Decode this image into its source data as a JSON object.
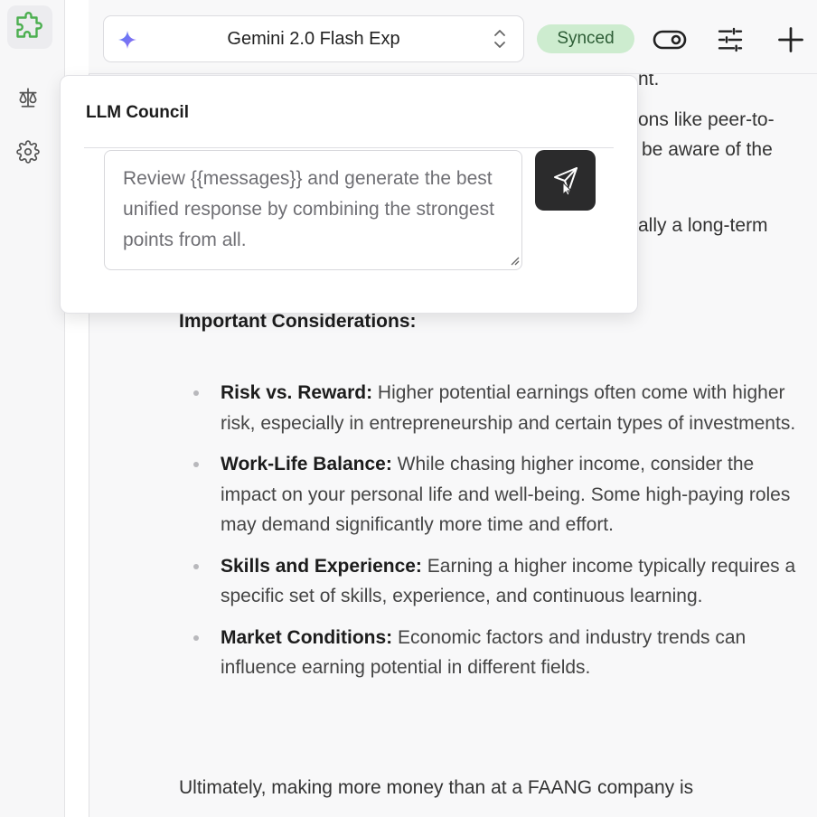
{
  "rail": {
    "items": [
      {
        "icon": "puzzle-icon"
      },
      {
        "icon": "scale-icon"
      },
      {
        "icon": "gear-icon"
      }
    ]
  },
  "topbar": {
    "model_label": "Gemini 2.0 Flash Exp",
    "model_icon": "sparkle-icon",
    "sync_badge": "Synced",
    "sync_badge_color": "#cdeccf",
    "actions": [
      "toggle-icon",
      "sliders-icon",
      "plus-icon"
    ]
  },
  "background_text": {
    "line1": "nt.",
    "line2": "ons like peer-to-",
    "line3": "be aware of the",
    "line4": "ally a long-term"
  },
  "content": {
    "heading": "Important Considerations:",
    "bullets": [
      {
        "title": "Risk vs. Reward:",
        "text": " Higher potential earnings often come with higher risk, especially in entrepreneurship and certain types of investments."
      },
      {
        "title": "Work-Life Balance:",
        "text": " While chasing higher income, consider the impact on your personal life and well-being. Some high-paying roles may demand significantly more time and effort."
      },
      {
        "title": "Skills and Experience:",
        "text": " Earning a higher income typically requires a specific set of skills, experience, and continuous learning."
      },
      {
        "title": "Market Conditions:",
        "text": " Economic factors and industry trends can influence earning potential in different fields."
      }
    ],
    "final": "Ultimately, making more money than at a FAANG company is"
  },
  "popup": {
    "title": "LLM Council",
    "prompt_value": "Review {{messages}} and generate the best unified response by combining the strongest points from all.",
    "send_icon": "send-icon"
  }
}
